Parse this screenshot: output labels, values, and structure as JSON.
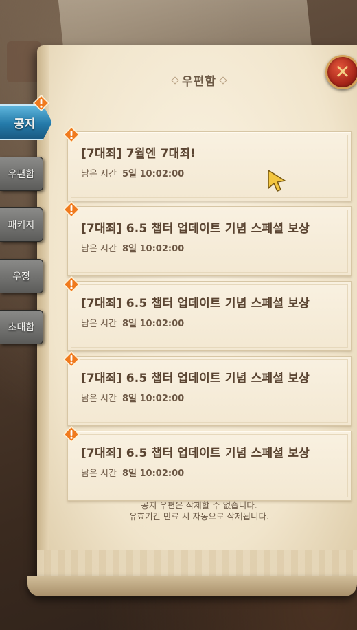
{
  "header": {
    "title": "우편함",
    "close_label": "✕"
  },
  "sidebar": {
    "items": [
      {
        "label": "공지",
        "active": true,
        "alert": true
      },
      {
        "label": "우편함",
        "active": false,
        "alert": false
      },
      {
        "label": "패키지",
        "active": false,
        "alert": false
      },
      {
        "label": "우정",
        "active": false,
        "alert": false
      },
      {
        "label": "초대함",
        "active": false,
        "alert": false
      }
    ]
  },
  "notices": [
    {
      "title": "[7대죄] 7월엔 7대죄!",
      "time_label": "남은 시간",
      "time_value": "5일 10:02:00"
    },
    {
      "title": "[7대죄] 6.5 챕터 업데이트 기념 스페셜 보상",
      "time_label": "남은 시간",
      "time_value": "8일 10:02:00"
    },
    {
      "title": "[7대죄] 6.5 챕터 업데이트 기념 스페셜 보상",
      "time_label": "남은 시간",
      "time_value": "8일 10:02:00"
    },
    {
      "title": "[7대죄] 6.5 챕터 업데이트 기념 스페셜 보상",
      "time_label": "남은 시간",
      "time_value": "8일 10:02:00"
    },
    {
      "title": "[7대죄] 6.5 챕터 업데이트 기념 스페셜 보상",
      "time_label": "남은 시간",
      "time_value": "8일 10:02:00"
    }
  ],
  "footer": {
    "line1": "공지 우편은 삭제할 수 없습니다.",
    "line2": "유효기간 만료 시 자동으로 삭제됩니다."
  },
  "icons": {
    "alert": "alert-icon",
    "close": "close-icon",
    "cursor": "cursor-icon"
  },
  "colors": {
    "active_tab": "#247aa9",
    "alert": "#f07a1e",
    "close_button": "#a8261a",
    "paper": "#f3e8d2"
  }
}
